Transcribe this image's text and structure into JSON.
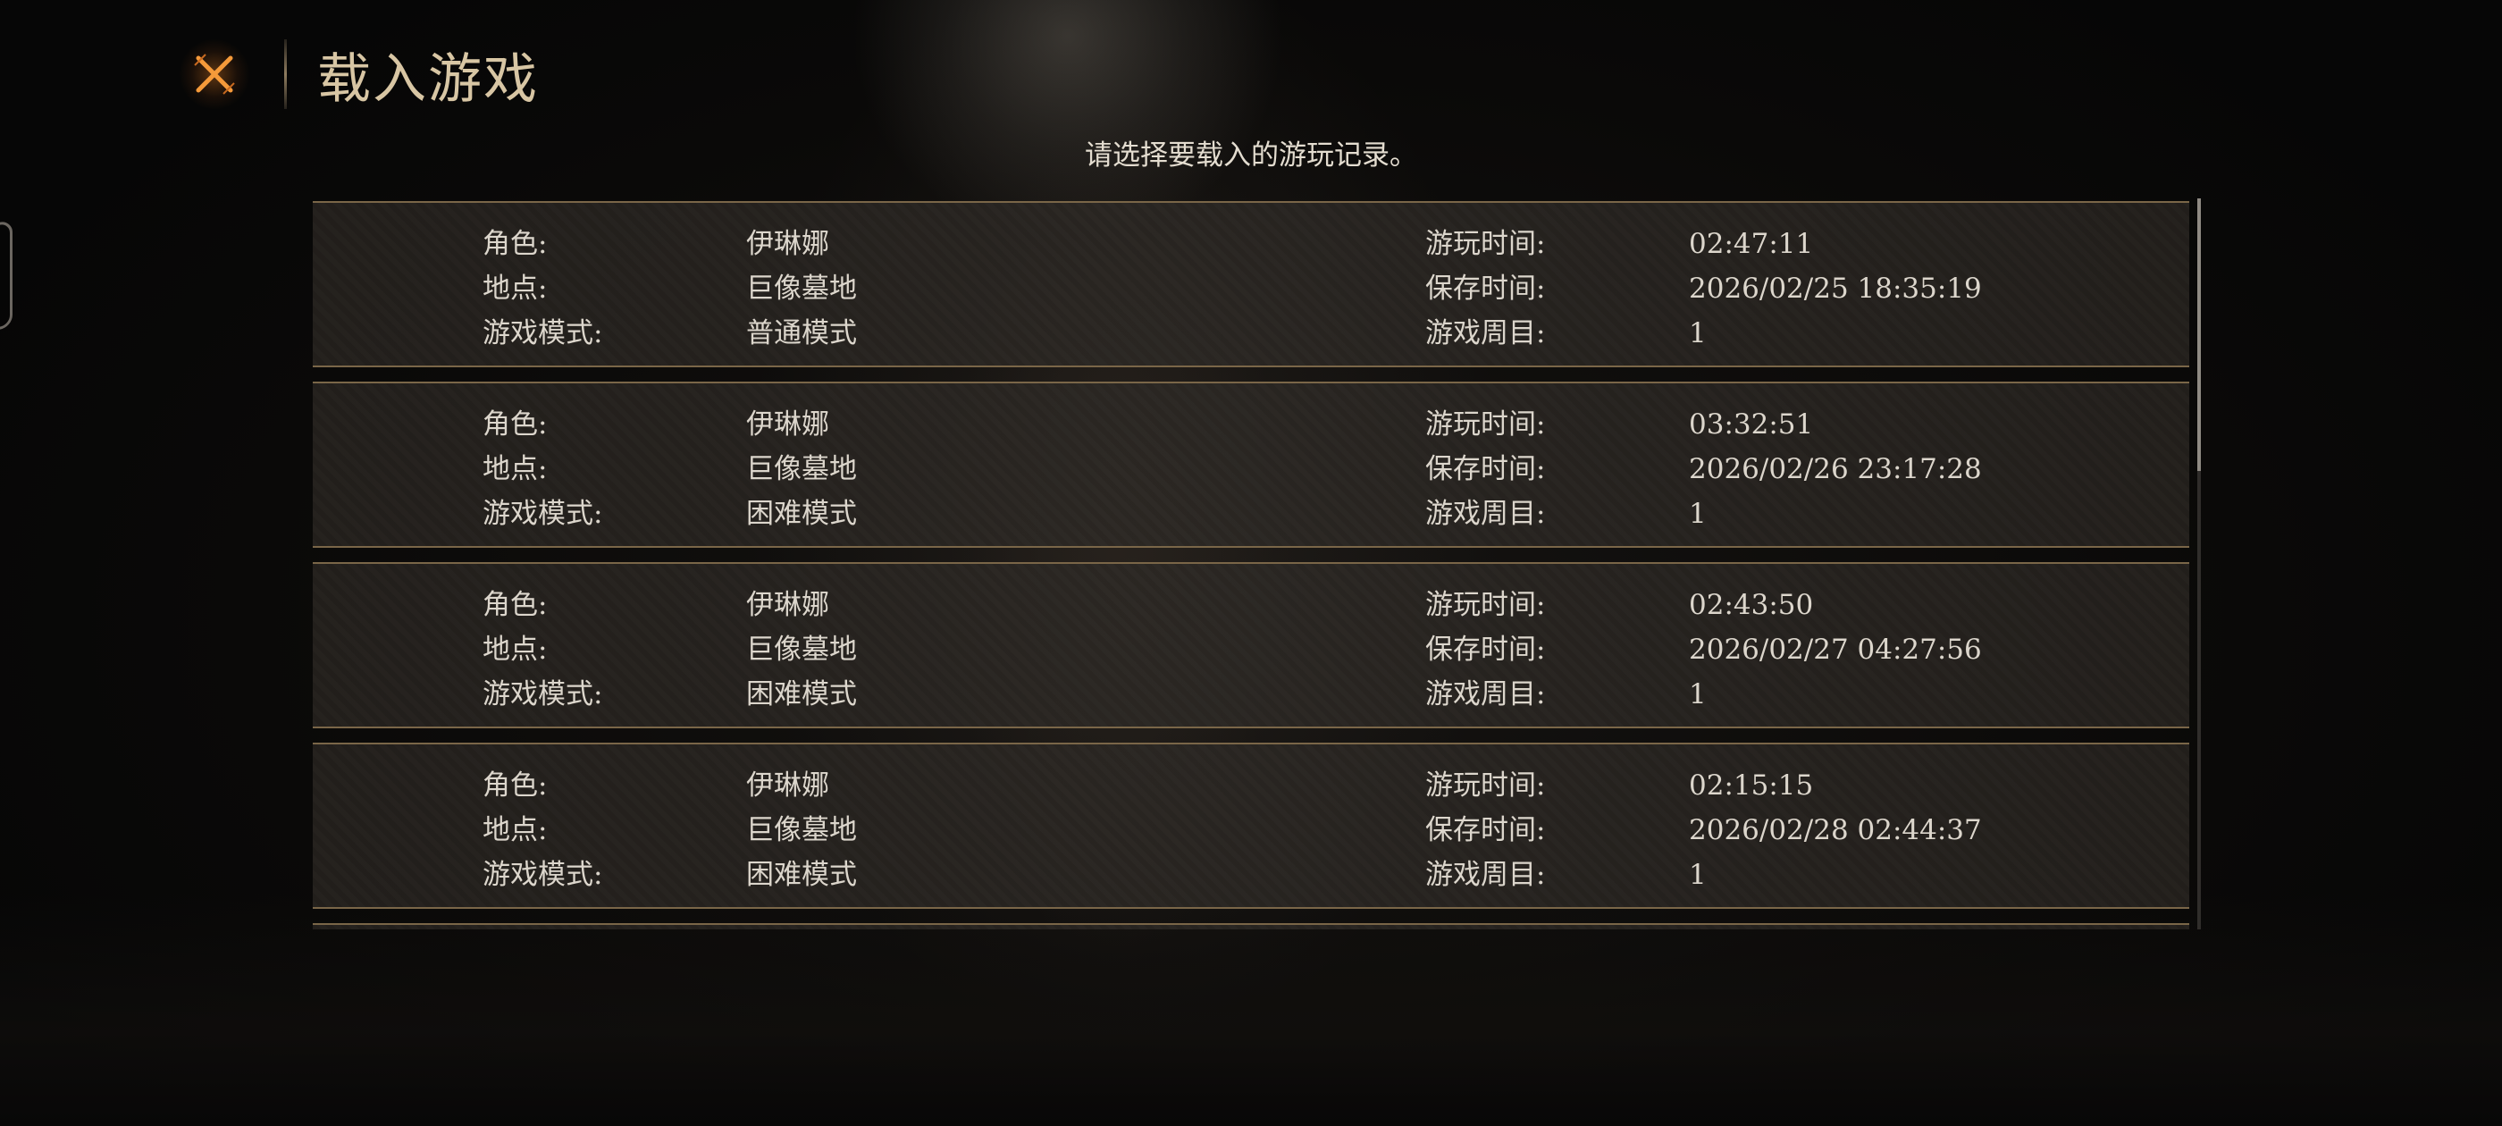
{
  "header": {
    "title": "载入游戏",
    "close_icon": "close-x-icon"
  },
  "subtitle": "请选择要载入的游玩记录。",
  "labels": {
    "character": "角色:",
    "location": "地点:",
    "mode": "游戏模式:",
    "playtime": "游玩时间:",
    "savetime": "保存时间:",
    "cycle": "游戏周目:"
  },
  "saves": [
    {
      "character": "伊琳娜",
      "location": "巨像墓地",
      "mode": "普通模式",
      "playtime": "02:47:11",
      "savetime": "2026/02/25 18:35:19",
      "cycle": "1"
    },
    {
      "character": "伊琳娜",
      "location": "巨像墓地",
      "mode": "困难模式",
      "playtime": "03:32:51",
      "savetime": "2026/02/26 23:17:28",
      "cycle": "1"
    },
    {
      "character": "伊琳娜",
      "location": "巨像墓地",
      "mode": "困难模式",
      "playtime": "02:43:50",
      "savetime": "2026/02/27 04:27:56",
      "cycle": "1"
    },
    {
      "character": "伊琳娜",
      "location": "巨像墓地",
      "mode": "困难模式",
      "playtime": "02:15:15",
      "savetime": "2026/02/28 02:44:37",
      "cycle": "1"
    }
  ],
  "colors": {
    "accent_gold": "#d8c6a4",
    "close_orange": "#f08a2a",
    "slot_border": "#7a6648"
  }
}
